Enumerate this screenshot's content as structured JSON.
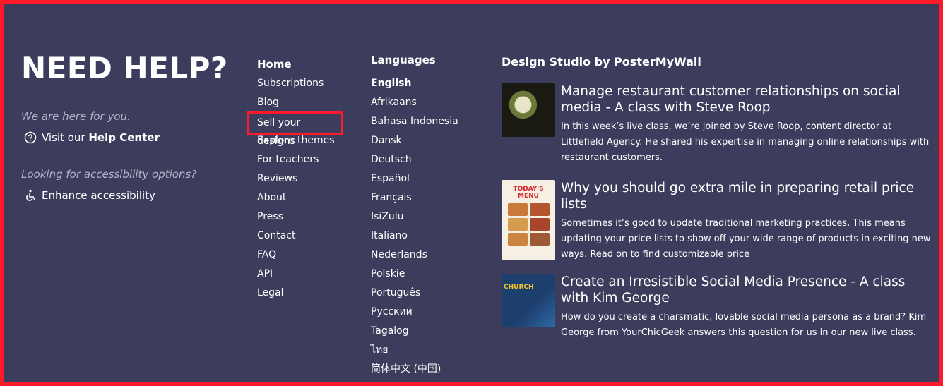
{
  "help": {
    "title": "NEED HELP?",
    "subtitle": "We are here for you.",
    "visit_prefix": "Visit our",
    "help_center": "Help Center",
    "access_subtitle": "Looking for accessibility options?",
    "access_link": "Enhance accessibility"
  },
  "nav": {
    "items": [
      "Home",
      "Subscriptions",
      "Blog",
      "Sell your designs",
      "Explore themes",
      "For teachers",
      "Reviews",
      "About",
      "Press",
      "Contact",
      "FAQ",
      "API",
      "Legal"
    ]
  },
  "languages": {
    "title": "Languages",
    "items": [
      "English",
      "Afrikaans",
      "Bahasa Indonesia",
      "Dansk",
      "Deutsch",
      "Español",
      "Français",
      "IsiZulu",
      "Italiano",
      "Nederlands",
      "Polskie",
      "Português",
      "Русский",
      "Tagalog",
      "ไทย",
      "简体中文 (中国)"
    ]
  },
  "studio": {
    "title": "Design Studio by PosterMyWall",
    "posts": [
      {
        "title": "Manage restaurant customer relationships on social media - A class with Steve Roop",
        "desc": "In this week’s live class, we’re joined by Steve Roop, content director at Littlefield Agency. He shared his expertise in managing online relationships with restaurant customers.",
        "thumb_icon": "food-plate-thumbnail"
      },
      {
        "title": "Why you should go extra mile in preparing retail price lists",
        "desc": "Sometimes it’s good to update traditional marketing practices. This means updating your price lists to show off your wide range of products in exciting new ways. Read on to find customizable price",
        "thumb_icon": "menu-poster-thumbnail",
        "thumb_text": "TODAY'S MENU"
      },
      {
        "title": "Create an Irresistible Social Media Presence - A class with Kim George",
        "desc": "How do you create a charsmatic, lovable social media persona as a brand? Kim George from YourChicGeek answers this question for us in our new live class.",
        "thumb_icon": "church-poster-thumbnail",
        "thumb_text": "CHURCH"
      }
    ]
  },
  "colors": {
    "background": "#3c3d5c",
    "highlight": "#ff1a2a",
    "muted": "#b2b3c7"
  }
}
